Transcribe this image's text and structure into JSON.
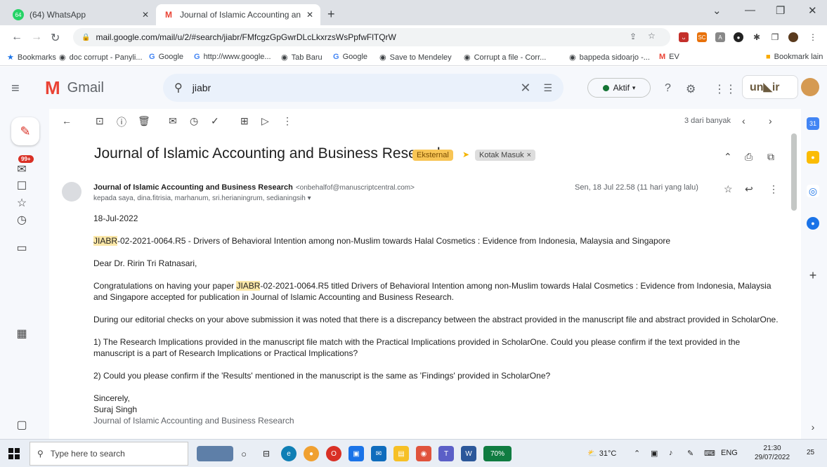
{
  "browser": {
    "tabs": [
      {
        "title": "(64) WhatsApp",
        "favicon": "whatsapp-icon",
        "favicon_text": "64",
        "color": "#25d366"
      },
      {
        "title": "Journal of Islamic Accounting an",
        "favicon": "gmail-icon",
        "favicon_text": "M",
        "color": "#ea4335"
      }
    ],
    "new_tab": "+",
    "url": "mail.google.com/mail/u/2/#search/jiabr/FMfcgzGpGwrDLcLkxrzsWsPpfwFlTQrW",
    "bookmarks": [
      {
        "label": "Bookmarks",
        "icon": "star-icon"
      },
      {
        "label": "doc corrupt - Panyli...",
        "icon": "globe-icon"
      },
      {
        "label": "Google",
        "icon": "google-icon"
      },
      {
        "label": "http://www.google...",
        "icon": "google-icon"
      },
      {
        "label": "Tab Baru",
        "icon": "globe-icon"
      },
      {
        "label": "Google",
        "icon": "google-icon"
      },
      {
        "label": "Save to Mendeley",
        "icon": "globe-icon"
      },
      {
        "label": "Corrupt a file - Corr...",
        "icon": "globe-icon"
      },
      {
        "label": "bappeda sidoarjo -...",
        "icon": "globe-icon"
      },
      {
        "label": "EV",
        "icon": "gmail-icon"
      }
    ],
    "other_bookmarks": "Bookmark lain"
  },
  "gmail": {
    "app_name": "Gmail",
    "search": {
      "value": "jiabr"
    },
    "status": "Aktif",
    "org_logo": "un◣ir",
    "rail_badge": "99+",
    "pager": "3 dari banyak",
    "subject": "Journal of Islamic Accounting and Business Research",
    "labels": {
      "external": "Eksternal",
      "inbox": "Kotak Masuk"
    },
    "sender": {
      "name": "Journal of Islamic Accounting and Business Research",
      "email": "<onbehalfof@manuscriptcentral.com>",
      "recipients": "kepada saya, dina.fitrisia, marhanum, sri.herianingrum, sedianingsih",
      "date": "Sen, 18 Jul 22.58 (11 hari yang lalu)"
    },
    "body": {
      "date_line": "18-Jul-2022",
      "highlight": "JIABR",
      "ms_line_rest": "-02-2021-0064.R5 - Drivers of Behavioral Intention among non-Muslim towards Halal Cosmetics : Evidence from Indonesia, Malaysia and Singapore",
      "greeting": "Dear Dr. Ririn Tri Ratnasari,",
      "congrats_a": "Congratulations on having your paper ",
      "congrats_b": "-02-2021-0064.R5 titled Drivers of Behavioral Intention among non-Muslim towards Halal Cosmetics : Evidence from Indonesia, Malaysia and Singapore accepted for publication in Journal of Islamic Accounting and Business Research.",
      "para_check": "During our editorial checks on your above submission it was noted that there is a discrepancy between the abstract provided in the manuscript file and abstract provided in ScholarOne.",
      "point1": "1) The Research Implications provided in the manuscript file match with the Practical Implications provided in ScholarOne. Could you please confirm if the text provided in the manuscript is a part of Research Implications or Practical Implications?",
      "point2": "2) Could you please confirm if the 'Results' mentioned in the manuscript is the same as 'Findings' provided in ScholarOne?",
      "closing": "Sincerely,",
      "signer": "Suraj Singh",
      "signer_org": "Journal of Islamic Accounting and Business Research"
    }
  },
  "taskbar": {
    "search_placeholder": "Type here to search",
    "battery": "70%",
    "weather": "31°C",
    "lang": "ENG",
    "time": "21:30",
    "date": "29/07/2022",
    "notif_count": "25"
  }
}
